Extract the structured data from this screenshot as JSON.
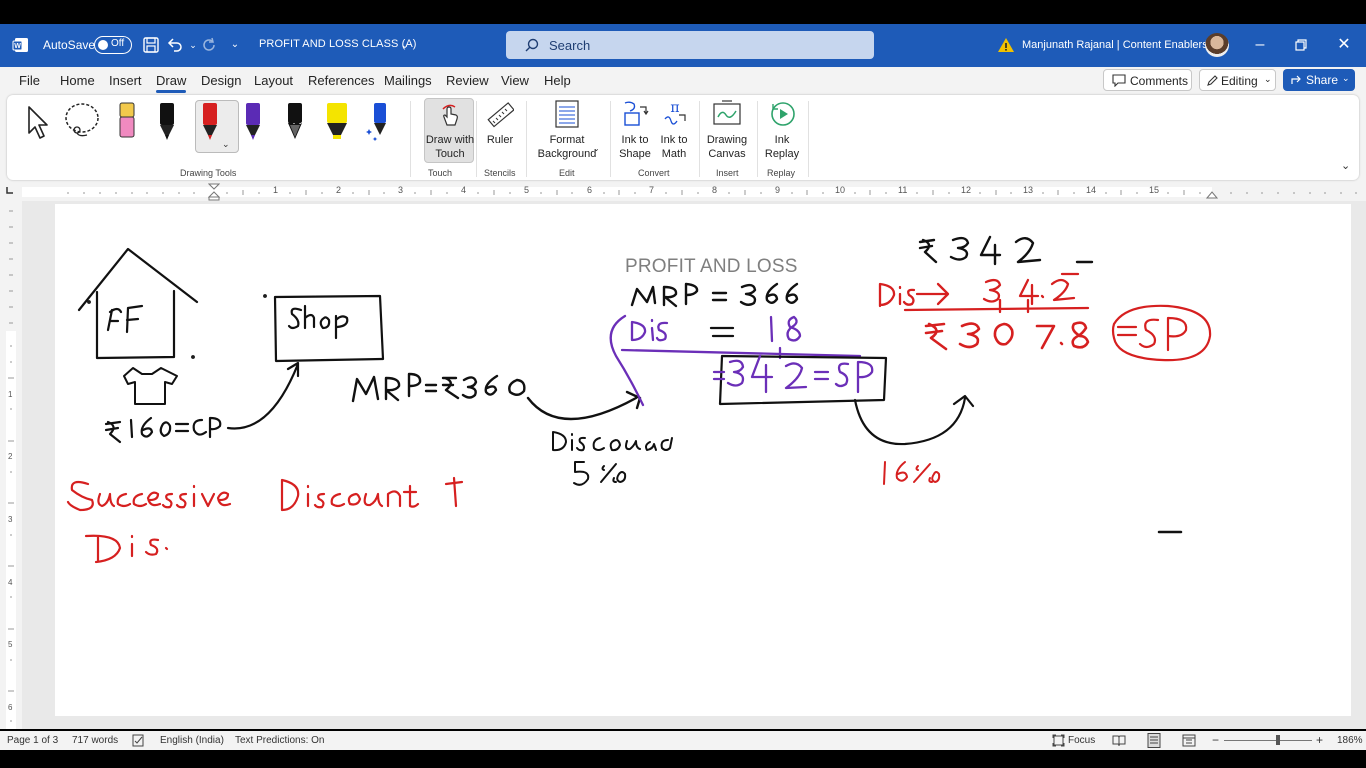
{
  "titlebar": {
    "autosave_label": "AutoSave",
    "autosave_state": "Off",
    "doc_title": "PROFIT AND LOSS CLASS (A)",
    "search_placeholder": "Search",
    "user_name": "Manjunath Rajanal | Content Enablers",
    "accent": "#1e5bb8"
  },
  "menu": {
    "tabs": [
      "File",
      "Home",
      "Insert",
      "Draw",
      "Design",
      "Layout",
      "References",
      "Mailings",
      "Review",
      "View",
      "Help"
    ],
    "active_tab": "Draw",
    "comments_label": "Comments",
    "editing_label": "Editing",
    "share_label": "Share"
  },
  "ribbon": {
    "groups": {
      "drawing_tools": "Drawing Tools",
      "touch": "Touch",
      "stencils": "Stencils",
      "edit": "Edit",
      "convert": "Convert",
      "insert": "Insert",
      "replay": "Replay"
    },
    "buttons": {
      "draw_with_touch_1": "Draw with",
      "draw_with_touch_2": "Touch",
      "ruler": "Ruler",
      "format_bg_1": "Format",
      "format_bg_2": "Background",
      "ink_shape_1": "Ink to",
      "ink_shape_2": "Shape",
      "ink_math_1": "Ink to",
      "ink_math_2": "Math",
      "drawing_canvas_1": "Drawing",
      "drawing_canvas_2": "Canvas",
      "ink_replay_1": "Ink",
      "ink_replay_2": "Replay"
    },
    "pen_colors": [
      "#f2c94c",
      "#111111",
      "#d62020",
      "#5b2bb5",
      "#111111",
      "#f4e400",
      "#1a4fd6"
    ]
  },
  "ruler": {
    "numbers": [
      "1",
      "2",
      "3",
      "4",
      "5",
      "6",
      "7",
      "8",
      "9",
      "10",
      "11",
      "12",
      "13",
      "14",
      "15"
    ]
  },
  "document": {
    "heading": "PROFIT AND LOSS"
  },
  "status": {
    "page": "Page 1 of 3",
    "words": "717 words",
    "language": "English (India)",
    "predictions": "Text Predictions: On",
    "focus": "Focus",
    "zoom": "186%"
  }
}
